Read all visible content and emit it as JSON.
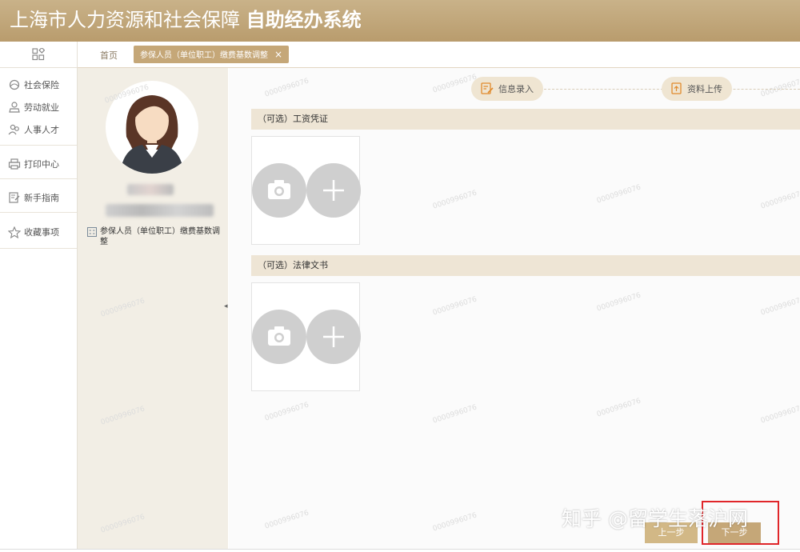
{
  "header": {
    "title_regular": "上海市人力资源和社会保障",
    "title_bold": "自助经办系统"
  },
  "tabs": {
    "home": "首页",
    "active": "参保人员（单位职工）缴费基数调整",
    "close": "×"
  },
  "sidebar": {
    "items": [
      {
        "label": "社会保险",
        "icon": "social-insurance-icon"
      },
      {
        "label": "劳动就业",
        "icon": "employment-icon"
      },
      {
        "label": "人事人才",
        "icon": "talent-icon"
      },
      {
        "label": "打印中心",
        "icon": "printer-icon"
      },
      {
        "label": "新手指南",
        "icon": "guide-icon"
      },
      {
        "label": "收藏事项",
        "icon": "star-icon"
      }
    ]
  },
  "profile": {
    "business_item": "参保人员（单位职工）缴费基数调整"
  },
  "steps": [
    {
      "label": "信息录入"
    },
    {
      "label": "资料上传"
    }
  ],
  "sections": [
    {
      "title": "（可选）工资凭证"
    },
    {
      "title": "（可选）法律文书"
    }
  ],
  "watermark": "0000996076",
  "buttons": {
    "prev": "上一步",
    "next": "下一步"
  },
  "credit": "知乎 @留学生落沪网",
  "colors": {
    "header": "#c2a87c",
    "accent": "#c5a778",
    "section_bar": "#eee5d5",
    "highlight": "#e0262a"
  }
}
